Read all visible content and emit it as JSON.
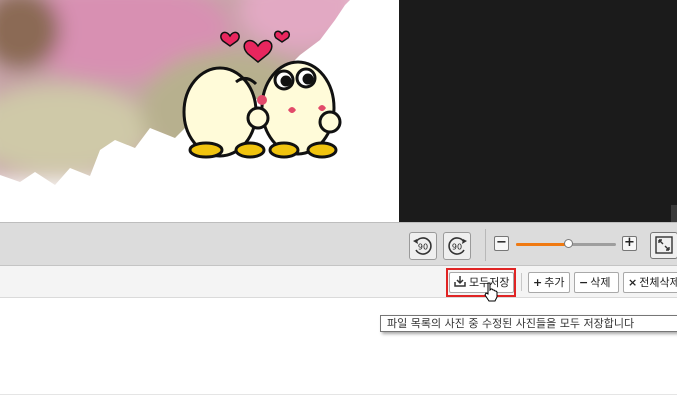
{
  "preview": {
    "image_icon": "couple-cartoon-image",
    "dark_panel_color": "#1b1b1b"
  },
  "toolbar": {
    "rotate_left_label": "90",
    "rotate_right_label": "90",
    "zoom_out_icon": "minus-icon",
    "zoom_in_icon": "plus-icon",
    "zoom_level": 0.52,
    "fit_icon": "fit-screen-icon",
    "accent": "#f07a12"
  },
  "filebar": {
    "save_all_label": "모두저장",
    "add_label": "추가",
    "delete_label": "삭제",
    "delete_all_label": "전체삭제"
  },
  "tooltip": {
    "text": "파일 목록의 사진 중 수정된 사진들을 모두 저장합니다"
  }
}
